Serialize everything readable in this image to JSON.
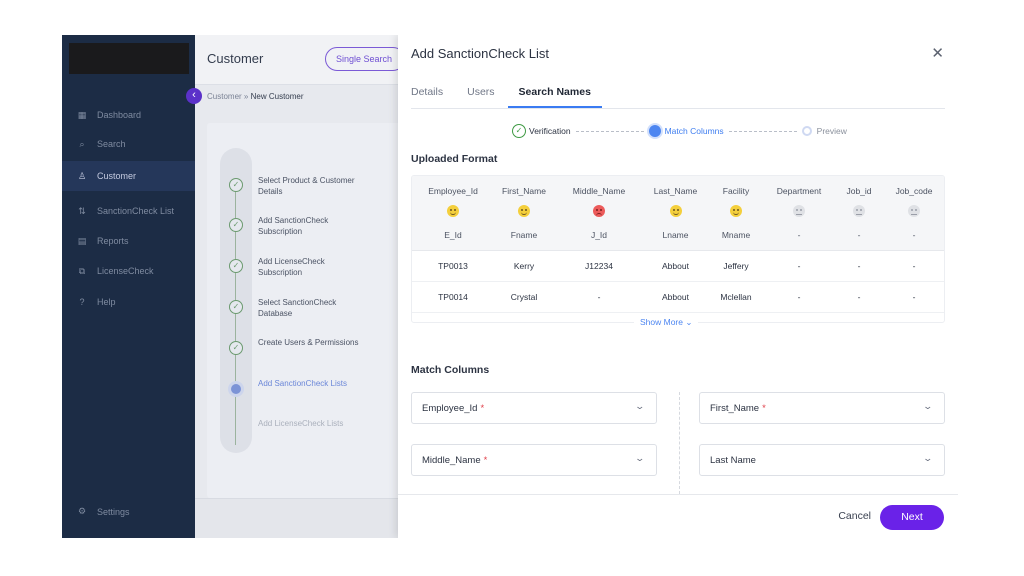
{
  "app": {
    "header_title": "Customer",
    "single_search_label": "Single Search",
    "breadcrumb": {
      "parent": "Customer",
      "separator": "»",
      "current": "New Customer"
    },
    "sidebar": [
      {
        "icon": "▦",
        "label": "Dashboard"
      },
      {
        "icon": "⌕",
        "label": "Search"
      },
      {
        "icon": "♙",
        "label": "Customer"
      },
      {
        "icon": "⇅",
        "label": "SanctionCheck List"
      },
      {
        "icon": "▤",
        "label": "Reports"
      },
      {
        "icon": "⧉",
        "label": "LicenseCheck"
      },
      {
        "icon": "?",
        "label": "Help"
      }
    ],
    "settings_label": "Settings",
    "collapse_icon": "‹",
    "steps": [
      {
        "label": "Select Product & Customer Details"
      },
      {
        "label": "Add SanctionCheck Subscription"
      },
      {
        "label": "Add LicenseCheck Subscription"
      },
      {
        "label": "Select SanctionCheck Database"
      },
      {
        "label": "Create Users & Permissions"
      },
      {
        "label": "Add SanctionCheck Lists"
      },
      {
        "label": "Add LicenseCheck Lists"
      }
    ]
  },
  "modal": {
    "title": "Add SanctionCheck List",
    "close_icon": "✕",
    "tabs": [
      {
        "label": "Details"
      },
      {
        "label": "Users"
      },
      {
        "label": "Search Names"
      }
    ],
    "stepper": {
      "step1": "Verification",
      "step2": "Match Columns",
      "step3": "Preview"
    },
    "uploaded_title": "Uploaded Format",
    "table": {
      "headers": [
        "Employee_Id",
        "First_Name",
        "Middle_Name",
        "Last_Name",
        "Facility",
        "Department",
        "Job_id",
        "Job_code"
      ],
      "status": [
        "good",
        "good",
        "bad",
        "good",
        "good",
        "none",
        "none",
        "none"
      ],
      "mapped": [
        "E_Id",
        "Fname",
        "J_Id",
        "Lname",
        "Mname",
        "-",
        "-",
        "-"
      ],
      "rows": [
        [
          "TP0013",
          "Kerry",
          "J12234",
          "Abbout",
          "Jeffery",
          "-",
          "-",
          "-"
        ],
        [
          "TP0014",
          "Crystal",
          "-",
          "Abbout",
          "Mclellan",
          "-",
          "-",
          "-"
        ]
      ]
    },
    "show_more": "Show More ⌄",
    "match_title": "Match Columns",
    "match_fields": [
      {
        "label": "Employee_Id",
        "required": "*"
      },
      {
        "label": "First_Name",
        "required": "*"
      },
      {
        "label": "Middle_Name",
        "required": "*"
      },
      {
        "label": "Last Name",
        "required": ""
      }
    ],
    "chevron": "⌄",
    "cancel_label": "Cancel",
    "next_label": "Next"
  },
  "colors": {
    "accent": "#6a22e8",
    "link": "#4d86f1",
    "success": "#3f9a44",
    "sidebar": "#1c2c45"
  }
}
